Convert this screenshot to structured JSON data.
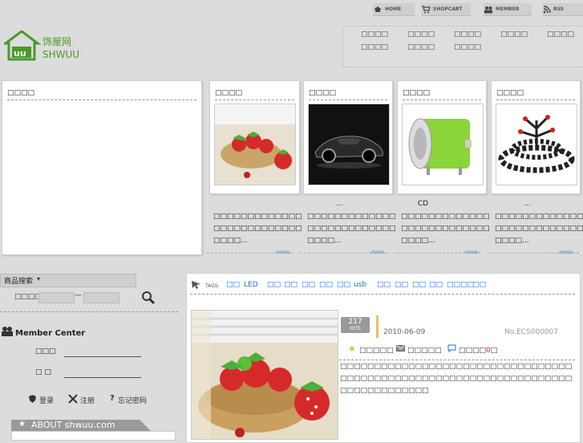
{
  "nav": {
    "items": [
      {
        "label": "HOME",
        "icon": "home-icon"
      },
      {
        "label": "SHOPCART",
        "icon": "cart-icon"
      },
      {
        "label": "MEMBER",
        "icon": "member-icon"
      },
      {
        "label": "RSS",
        "icon": "rss-icon"
      }
    ]
  },
  "logo": {
    "text": "SHWUU",
    "cn": "饰屋网"
  },
  "categories": [
    "□□□□",
    "□□□□",
    "□□□□",
    "□□□□",
    "□□□□",
    "□□□□",
    "□□□□",
    "□□□□"
  ],
  "notice": {
    "title": "□□□□"
  },
  "products": [
    {
      "title": "□□□□",
      "name": "",
      "desc": "□□□□□□□□□□□□□□□□□□□□□□□□□□□□□□...",
      "more": "-more-"
    },
    {
      "title": "□□□□",
      "name": "...",
      "desc": "□□□□□□□□□□□□□□□□□□□□□□□□□□□□□□...",
      "more": "-more-"
    },
    {
      "title": "□□□□",
      "name": "CD",
      "desc": "□□□□□□□□□□□□□□□□□□□□□□□□□□□□□□...",
      "more": "-more-"
    },
    {
      "title": "□□□□",
      "name": "...",
      "desc": "□□□□□□□□□□□□□□□□□□□□□□□□□□□□□□...",
      "more": "-more-"
    }
  ],
  "search": {
    "title": "商品搜索",
    "price_label": "□□□□",
    "dash": "—"
  },
  "member": {
    "title": "Member Center",
    "user_label": "□□□",
    "pass_label": "□ □",
    "login": "登录",
    "register": "注册",
    "forgot": "忘记密码"
  },
  "about": {
    "label": "ABOUT shwuu.com"
  },
  "tags": {
    "label": "TAGS:",
    "items": [
      "□□",
      "LED",
      "□□",
      "□□",
      "□□",
      "□□",
      "□□",
      "usb",
      "□□",
      "□□",
      "□□",
      "□□",
      "□□□□",
      "□□"
    ]
  },
  "feature": {
    "hits": "217",
    "hits_label": "HITS",
    "date": "2010-06-09",
    "code": "No.ECS000007",
    "favorite": "□□□□□",
    "message": "□□□□□",
    "comments_prefix": "□□□□",
    "comments_count": "0",
    "comments_suffix": "□",
    "desc": "□□□□□□□□□□□□□□□□□□□□□□□□□□□□□□□□□□□□□□□□□□□□□□□□□□□□□□□□□□□□□□□□□□□□□□□□□□□□□□□□□"
  },
  "colors": {
    "accent": "#1a8bc8",
    "tag": "#1a6ed8",
    "brand": "#4a9a2a",
    "highlight": "#e8c060",
    "red": "#e02020"
  }
}
